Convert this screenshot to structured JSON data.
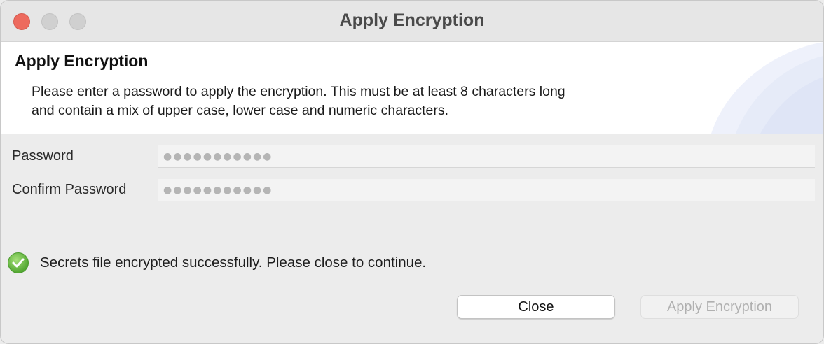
{
  "window": {
    "title": "Apply Encryption"
  },
  "header": {
    "title": "Apply Encryption",
    "description_line1": "Please enter a password to apply the encryption. This must be at least 8 characters long",
    "description_line2": "and contain a mix of upper case, lower case and numeric characters."
  },
  "form": {
    "password_label": "Password",
    "password_value": "●●●●●●●●●●●",
    "confirm_label": "Confirm Password",
    "confirm_value": "●●●●●●●●●●●"
  },
  "status": {
    "icon": "check-circle-icon",
    "message": "Secrets file encrypted successfully. Please close to continue."
  },
  "buttons": {
    "close_label": "Close",
    "apply_label": "Apply Encryption"
  },
  "colors": {
    "close_traffic": "#ed6a5e",
    "success": "#55a934"
  }
}
